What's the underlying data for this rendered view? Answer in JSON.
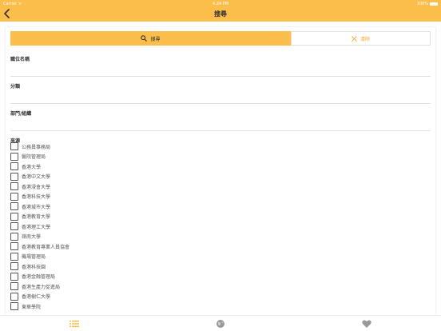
{
  "status_bar": {
    "carrier": "Carrier ᯤ",
    "time": "4:24 PM",
    "battery": "100%"
  },
  "nav": {
    "title": "搜尋"
  },
  "buttons": {
    "search_label": "搜尋",
    "clear_label": "清除"
  },
  "fields": {
    "job_title_label": "職位名稱",
    "category_label": "分類",
    "department_label": "部門/組織"
  },
  "sources": {
    "label": "來源",
    "items": [
      "公務員事務局",
      "醫院管理局",
      "香港大學",
      "香港中文大學",
      "香港浸會大學",
      "香港科技大學",
      "香港城市大學",
      "香港教育大學",
      "香港理工大學",
      "嶺南大學",
      "香港教育專業人員協會",
      "機場管理局",
      "香港科技園",
      "香港金融管理局",
      "香港生產力促進局",
      "香港樹仁大學",
      "東華學院"
    ]
  },
  "colors": {
    "accent": "#fbbe4b",
    "clear_text": "#f4a92a"
  },
  "tabbar": {
    "icons": [
      "list-icon",
      "globe-icon",
      "heart-icon"
    ]
  }
}
